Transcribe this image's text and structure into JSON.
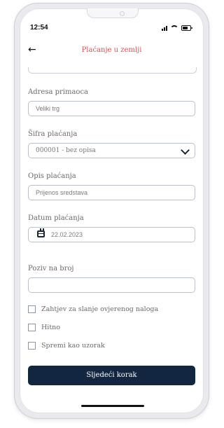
{
  "status_bar": {
    "time": "12:54"
  },
  "header": {
    "title": "Plaćanje u zemlji"
  },
  "form": {
    "recipient_address": {
      "label": "Adresa primaoca",
      "value": "Veliki trg"
    },
    "payment_code": {
      "label": "Šifra plaćanja",
      "value": "000001 - bez opisa"
    },
    "payment_description": {
      "label": "Opis plaćanja",
      "value": "Prijenos sredstava"
    },
    "payment_date": {
      "label": "Datum plaćanja",
      "value": "22.02.2023"
    },
    "reference_number": {
      "label": "Poziv na broj",
      "value": ""
    }
  },
  "options": [
    {
      "label": "Zahtjev za slanje ovjerenog naloga",
      "checked": false
    },
    {
      "label": "Hitno",
      "checked": false
    },
    {
      "label": "Spremi kao uzorak",
      "checked": false
    }
  ],
  "actions": {
    "next_label": "Sljedeći korak"
  },
  "colors": {
    "accent_title": "#d25555",
    "primary_button": "#12263f"
  },
  "icons": [
    "back-arrow-icon",
    "chevron-down-icon",
    "calendar-icon",
    "signal-icon",
    "wifi-icon",
    "battery-icon"
  ]
}
